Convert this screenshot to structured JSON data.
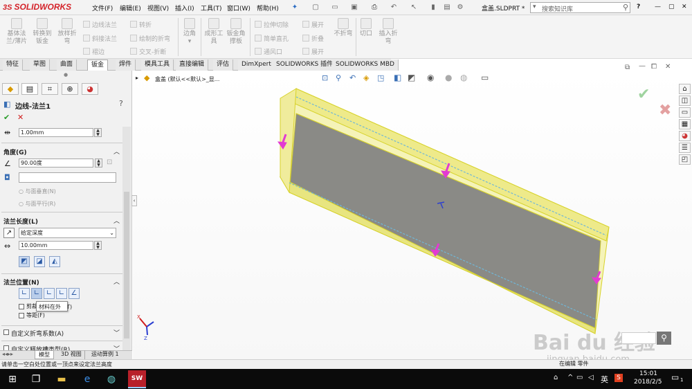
{
  "app": {
    "logo_text": "SOLIDWORKS",
    "menus": [
      "文件(F)",
      "编辑(E)",
      "视图(V)",
      "插入(I)",
      "工具(T)",
      "窗口(W)",
      "帮助(H)"
    ],
    "doc_title": "盒盖.SLDPRT *",
    "search_placeholder": "搜索知识库",
    "help_label": "?"
  },
  "ribbon": {
    "big_buttons": [
      {
        "label": "基体法兰/薄片",
        "icon": "base-flange-icon"
      },
      {
        "label": "转换到钣金",
        "icon": "convert-sheet-metal-icon"
      },
      {
        "label": "放样折弯",
        "icon": "lofted-bend-icon"
      },
      {
        "label": "边角",
        "icon": "corners-icon"
      },
      {
        "label": "成形工具",
        "icon": "forming-tool-icon"
      },
      {
        "label": "钣金角撑板",
        "icon": "sheet-metal-gusset-icon"
      },
      {
        "label": "不折弯",
        "icon": "no-bends-icon"
      },
      {
        "label": "切口",
        "icon": "rip-icon"
      },
      {
        "label": "插入折弯",
        "icon": "insert-bends-icon"
      }
    ],
    "small_buttons": [
      "边线法兰",
      "斜接法兰",
      "褶边",
      "转折",
      "绘制的折弯",
      "交叉-折断",
      "拉伸切除",
      "简单直孔",
      "通风口",
      "展开",
      "折叠",
      "展开"
    ]
  },
  "tabs": [
    "特征",
    "草图",
    "曲面",
    "钣金",
    "焊件",
    "模具工具",
    "直接编辑",
    "评估",
    "DimXpert",
    "SOLIDWORKS 插件",
    "SOLIDWORKS MBD"
  ],
  "property_manager": {
    "title": "边线-法兰1",
    "thickness_value": "1.00mm",
    "angle_section": "角度(G)",
    "angle_value": "90.00度",
    "angle_opt1": "与面垂直(N)",
    "angle_opt2": "与面平行(R)",
    "length_section": "法兰长度(L)",
    "end_condition": "给定深度",
    "length_value": "10.00mm",
    "position_section": "法兰位置(N)",
    "tooltip": "材料在外",
    "trim_label": "剪裁",
    "trim_suffix": "(T)",
    "offset_label": "等距(F)",
    "custom_bend": "自定义折弯系数(A)",
    "custom_relief": "自定义释放槽类型(R)"
  },
  "viewport": {
    "tree_label": "盒盖  (默认<<默认>_显..."
  },
  "bottom_tabs": [
    "模型",
    "3D 视图",
    "运动算例 1"
  ],
  "status_text": "请单击一空白处位置或一顶点来设定法兰高度",
  "status_right": "在编辑 零件",
  "taskbar": {
    "time": "15:01",
    "date": "2018/2/5",
    "ime": "英",
    "notify_count": "1"
  },
  "watermark": {
    "brand": "Bai du 经验",
    "url": "jingyan.baidu.com"
  },
  "colors": {
    "brand_red": "#d4232a",
    "model_yellow": "#f2f26a",
    "face_gray": "#8a8a86",
    "arrow_magenta": "#e23bd2",
    "taskbar": "#0b0b0b"
  }
}
